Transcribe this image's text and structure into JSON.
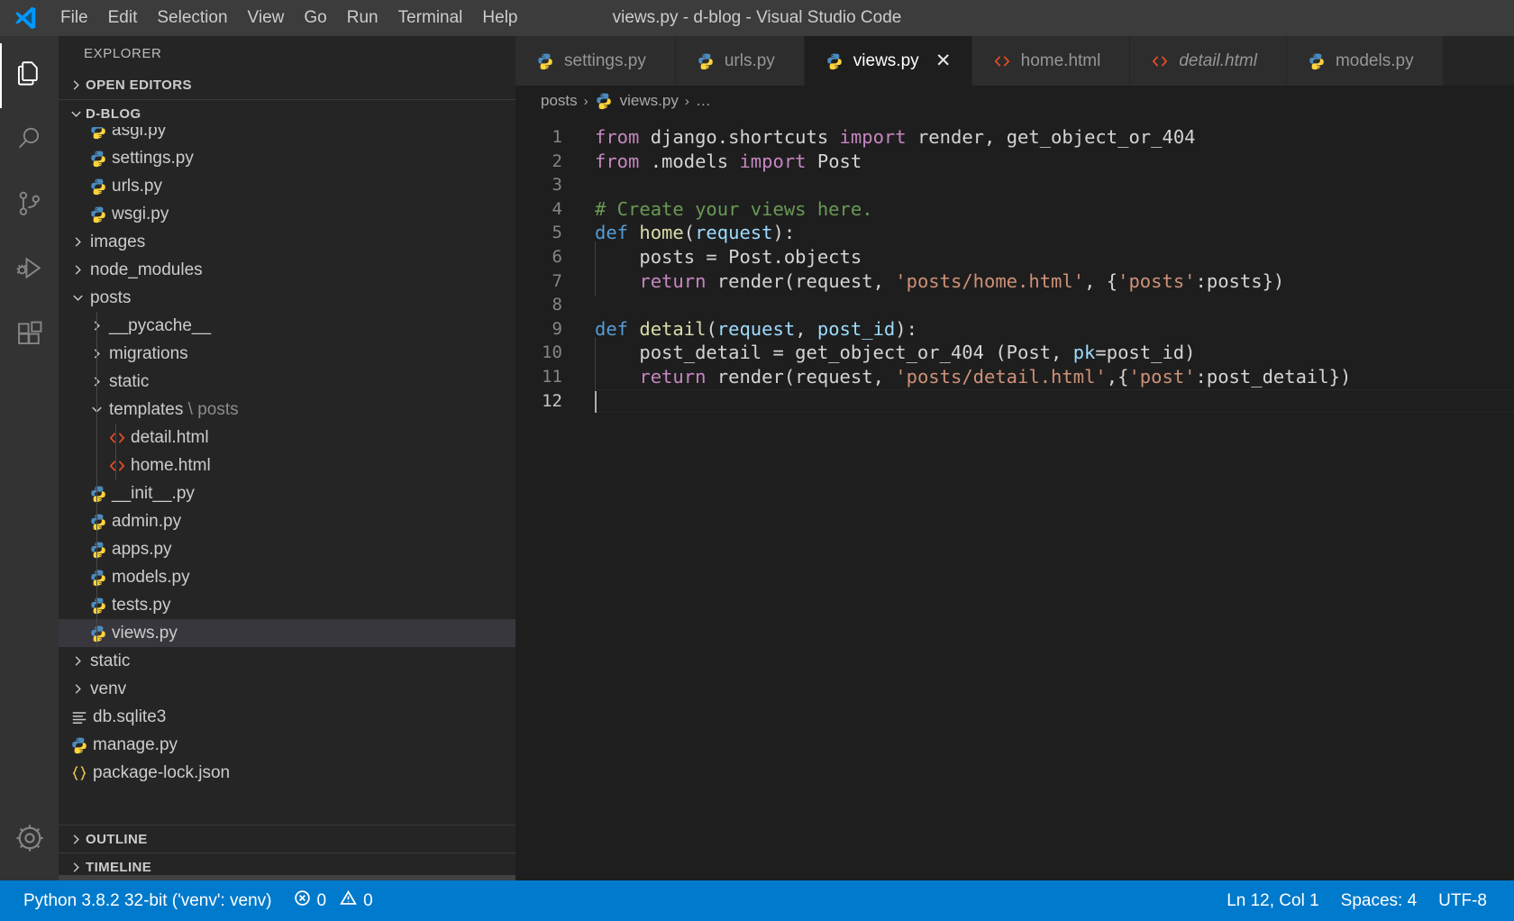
{
  "titlebar": {
    "window_title": "views.py - d-blog - Visual Studio Code",
    "logo": "vscode-logo",
    "menus": [
      {
        "label": "File"
      },
      {
        "label": "Edit"
      },
      {
        "label": "Selection"
      },
      {
        "label": "View"
      },
      {
        "label": "Go"
      },
      {
        "label": "Run"
      },
      {
        "label": "Terminal"
      },
      {
        "label": "Help"
      }
    ]
  },
  "activitybar": {
    "items": [
      {
        "name": "explorer",
        "icon": "files-icon",
        "active": true
      },
      {
        "name": "search",
        "icon": "search-icon",
        "active": false
      },
      {
        "name": "source-control",
        "icon": "source-control-icon",
        "active": false
      },
      {
        "name": "run-and-debug",
        "icon": "run-debug-icon",
        "active": false
      },
      {
        "name": "extensions",
        "icon": "extensions-icon",
        "active": false
      }
    ],
    "bottom": [
      {
        "name": "manage",
        "icon": "gear-icon"
      }
    ]
  },
  "sidebar": {
    "title": "EXPLORER",
    "open_editors_label": "OPEN EDITORS",
    "project_label": "D-BLOG",
    "outline_label": "OUTLINE",
    "timeline_label": "TIMELINE",
    "tree": [
      {
        "label": "asgi.py",
        "icon": "python-file-icon",
        "depth": 2,
        "kind": "file",
        "clipped": true
      },
      {
        "label": "settings.py",
        "icon": "python-file-icon",
        "depth": 2,
        "kind": "file"
      },
      {
        "label": "urls.py",
        "icon": "python-file-icon",
        "depth": 2,
        "kind": "file"
      },
      {
        "label": "wsgi.py",
        "icon": "python-file-icon",
        "depth": 2,
        "kind": "file"
      },
      {
        "label": "images",
        "icon": "chevron-right-icon",
        "depth": 1,
        "kind": "folder",
        "expanded": false
      },
      {
        "label": "node_modules",
        "icon": "chevron-right-icon",
        "depth": 1,
        "kind": "folder",
        "expanded": false
      },
      {
        "label": "posts",
        "icon": "chevron-down-icon",
        "depth": 1,
        "kind": "folder",
        "expanded": true
      },
      {
        "label": "__pycache__",
        "icon": "chevron-right-icon",
        "depth": 2,
        "kind": "folder",
        "expanded": false
      },
      {
        "label": "migrations",
        "icon": "chevron-right-icon",
        "depth": 2,
        "kind": "folder",
        "expanded": false
      },
      {
        "label": "static",
        "icon": "chevron-right-icon",
        "depth": 2,
        "kind": "folder",
        "expanded": false
      },
      {
        "label": "templates",
        "suffix": " \\ posts",
        "icon": "chevron-down-icon",
        "depth": 2,
        "kind": "folder",
        "expanded": true
      },
      {
        "label": "detail.html",
        "icon": "html-file-icon",
        "depth": 3,
        "kind": "file"
      },
      {
        "label": "home.html",
        "icon": "html-file-icon",
        "depth": 3,
        "kind": "file"
      },
      {
        "label": "__init__.py",
        "icon": "python-file-icon",
        "depth": 2,
        "kind": "file"
      },
      {
        "label": "admin.py",
        "icon": "python-file-icon",
        "depth": 2,
        "kind": "file"
      },
      {
        "label": "apps.py",
        "icon": "python-file-icon",
        "depth": 2,
        "kind": "file"
      },
      {
        "label": "models.py",
        "icon": "python-file-icon",
        "depth": 2,
        "kind": "file"
      },
      {
        "label": "tests.py",
        "icon": "python-file-icon",
        "depth": 2,
        "kind": "file"
      },
      {
        "label": "views.py",
        "icon": "python-file-icon",
        "depth": 2,
        "kind": "file",
        "selected": true
      },
      {
        "label": "static",
        "icon": "chevron-right-icon",
        "depth": 1,
        "kind": "folder",
        "expanded": false
      },
      {
        "label": "venv",
        "icon": "chevron-right-icon",
        "depth": 1,
        "kind": "folder",
        "expanded": false
      },
      {
        "label": "db.sqlite3",
        "icon": "database-file-icon",
        "depth": 1,
        "kind": "file"
      },
      {
        "label": "manage.py",
        "icon": "python-file-icon",
        "depth": 1,
        "kind": "file"
      },
      {
        "label": "package-lock.json",
        "icon": "json-file-icon",
        "depth": 1,
        "kind": "file",
        "clipped": true
      }
    ]
  },
  "editor": {
    "tabs": [
      {
        "label": "settings.py",
        "icon": "python-file-icon",
        "active": false,
        "preview": false,
        "closable": false
      },
      {
        "label": "urls.py",
        "icon": "python-file-icon",
        "active": false,
        "preview": false,
        "closable": false
      },
      {
        "label": "views.py",
        "icon": "python-file-icon",
        "active": true,
        "preview": false,
        "closable": true,
        "close_label": "✕"
      },
      {
        "label": "home.html",
        "icon": "html-file-icon",
        "active": false,
        "preview": false,
        "closable": false
      },
      {
        "label": "detail.html",
        "icon": "html-file-icon",
        "active": false,
        "preview": true,
        "closable": false
      },
      {
        "label": "models.py",
        "icon": "python-file-icon",
        "active": false,
        "preview": false,
        "closable": false
      }
    ],
    "breadcrumbs": [
      {
        "label": "posts",
        "icon": null
      },
      {
        "label": "views.py",
        "icon": "python-file-icon"
      },
      {
        "label": "…",
        "icon": null
      }
    ],
    "breadcrumb_separator": "›",
    "lines": [
      {
        "n": "1",
        "tokens": [
          {
            "t": "from ",
            "c": "kw"
          },
          {
            "t": "django.shortcuts ",
            "c": "pl"
          },
          {
            "t": "import ",
            "c": "kw"
          },
          {
            "t": "render, get_object_or_404",
            "c": "pl"
          }
        ]
      },
      {
        "n": "2",
        "tokens": [
          {
            "t": "from ",
            "c": "kw"
          },
          {
            "t": ".models ",
            "c": "pl"
          },
          {
            "t": "import ",
            "c": "kw"
          },
          {
            "t": "Post",
            "c": "pl"
          }
        ]
      },
      {
        "n": "3",
        "tokens": []
      },
      {
        "n": "4",
        "tokens": [
          {
            "t": "# Create your views here.",
            "c": "cmt"
          }
        ]
      },
      {
        "n": "5",
        "tokens": [
          {
            "t": "def ",
            "c": "kw2"
          },
          {
            "t": "home",
            "c": "fn"
          },
          {
            "t": "(",
            "c": "pl"
          },
          {
            "t": "request",
            "c": "id"
          },
          {
            "t": "):",
            "c": "pl"
          }
        ]
      },
      {
        "n": "6",
        "indent": true,
        "tokens": [
          {
            "t": "    posts = Post.objects",
            "c": "pl"
          }
        ]
      },
      {
        "n": "7",
        "indent": true,
        "tokens": [
          {
            "t": "    ",
            "c": "pl"
          },
          {
            "t": "return ",
            "c": "kw"
          },
          {
            "t": "render(request, ",
            "c": "pl"
          },
          {
            "t": "'posts/home.html'",
            "c": "str"
          },
          {
            "t": ", {",
            "c": "pl"
          },
          {
            "t": "'posts'",
            "c": "str"
          },
          {
            "t": ":posts})",
            "c": "pl"
          }
        ]
      },
      {
        "n": "8",
        "tokens": []
      },
      {
        "n": "9",
        "tokens": [
          {
            "t": "def ",
            "c": "kw2"
          },
          {
            "t": "detail",
            "c": "fn"
          },
          {
            "t": "(",
            "c": "pl"
          },
          {
            "t": "request",
            "c": "id"
          },
          {
            "t": ", ",
            "c": "pl"
          },
          {
            "t": "post_id",
            "c": "id"
          },
          {
            "t": "):",
            "c": "pl"
          }
        ]
      },
      {
        "n": "10",
        "indent": true,
        "tokens": [
          {
            "t": "    post_detail = get_object_or_404 (Post, ",
            "c": "pl"
          },
          {
            "t": "pk",
            "c": "id"
          },
          {
            "t": "=post_id)",
            "c": "pl"
          }
        ]
      },
      {
        "n": "11",
        "indent": true,
        "tokens": [
          {
            "t": "    ",
            "c": "pl"
          },
          {
            "t": "return ",
            "c": "kw"
          },
          {
            "t": "render(request, ",
            "c": "pl"
          },
          {
            "t": "'posts/detail.html'",
            "c": "str"
          },
          {
            "t": ",{",
            "c": "pl"
          },
          {
            "t": "'post'",
            "c": "str"
          },
          {
            "t": ":post_detail})",
            "c": "pl"
          }
        ]
      },
      {
        "n": "12",
        "tokens": [],
        "current": true
      }
    ]
  },
  "statusbar": {
    "python_interpreter": "Python 3.8.2 32-bit ('venv': venv)",
    "errors_count": "0",
    "warnings_count": "0",
    "cursor_position": "Ln 12, Col 1",
    "indentation": "Spaces: 4",
    "encoding": "UTF-8",
    "accent_color": "#007acc"
  }
}
